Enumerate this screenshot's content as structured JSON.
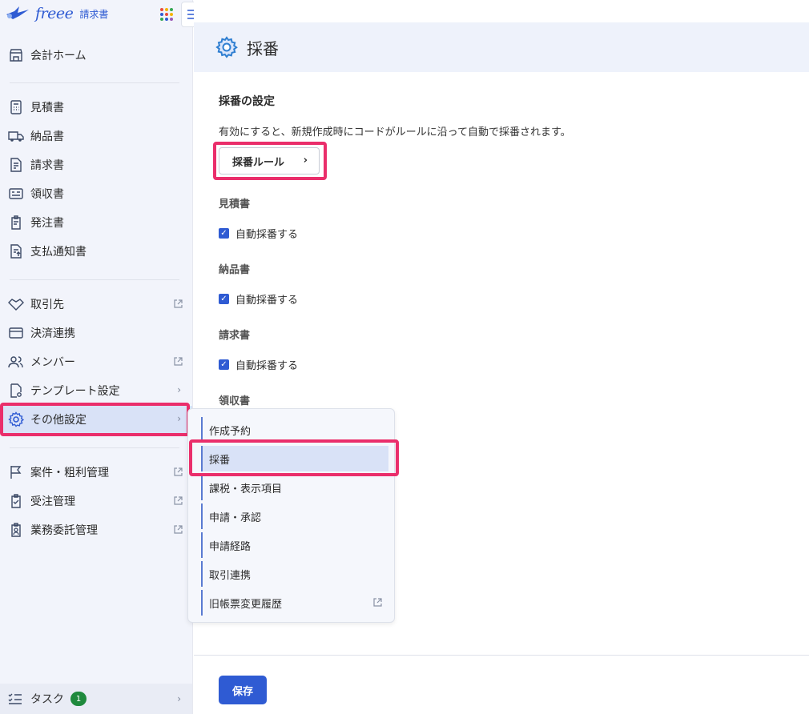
{
  "app": {
    "brand": "freee",
    "product": "請求書"
  },
  "sidebar": {
    "home": "会計ホーム",
    "docs": [
      "見積書",
      "納品書",
      "請求書",
      "領収書",
      "発注書",
      "支払通知書"
    ],
    "settings": [
      "取引先",
      "決済連携",
      "メンバー",
      "テンプレート設定",
      "その他設定"
    ],
    "other": [
      "案件・粗利管理",
      "受注管理",
      "業務委託管理"
    ],
    "task_label": "タスク",
    "task_count": "1"
  },
  "header": {
    "title": "採番"
  },
  "main": {
    "section_title": "採番の設定",
    "description": "有効にすると、新規作成時にコードがルールに沿って自動で採番されます。",
    "rule_button": "採番ルール",
    "documents": [
      {
        "label": "見積書",
        "checkbox": "自動採番する",
        "checked": true
      },
      {
        "label": "納品書",
        "checkbox": "自動採番する",
        "checked": true
      },
      {
        "label": "請求書",
        "checkbox": "自動採番する",
        "checked": true
      },
      {
        "label": "領収書"
      }
    ],
    "save_button": "保存"
  },
  "flyout": {
    "items": [
      "作成予約",
      "採番",
      "課税・表示項目",
      "申請・承認",
      "申請経路",
      "取引連携",
      "旧帳票変更履歴"
    ],
    "active": "採番"
  },
  "colors": {
    "accent": "#2f5bd3",
    "highlight": "#ea2e6b",
    "badge": "#1f8a3d"
  }
}
